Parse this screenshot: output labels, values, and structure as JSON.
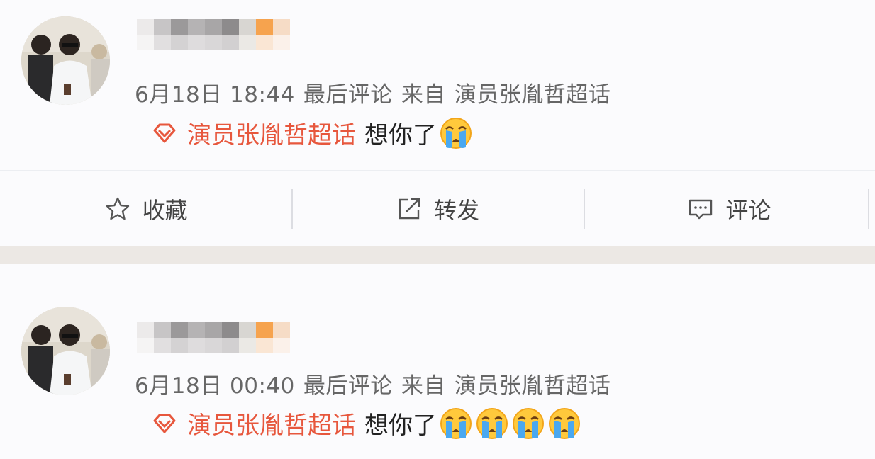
{
  "posts": [
    {
      "time": "6月18日 18:44",
      "last_comment": "最后评论",
      "from_label": "来自",
      "source": "演员张胤哲超话",
      "topic": "演员张胤哲超话",
      "text": "想你了",
      "emoji_count": 1,
      "emoji_icon": "crying-face-icon"
    },
    {
      "time": "6月18日 00:40",
      "last_comment": "最后评论",
      "from_label": "来自",
      "source": "演员张胤哲超话",
      "topic": "演员张胤哲超话",
      "text": "想你了",
      "emoji_count": 4,
      "emoji_icon": "crying-face-icon"
    }
  ],
  "actions": [
    {
      "label": "收藏",
      "icon": "star-outline-icon"
    },
    {
      "label": "转发",
      "icon": "share-external-icon"
    },
    {
      "label": "评论",
      "icon": "comment-bubble-icon"
    }
  ],
  "colors": {
    "topic": "#e7573d",
    "meta": "#666666",
    "background": "#fbfbfd",
    "divider_band": "#ece8e4"
  }
}
